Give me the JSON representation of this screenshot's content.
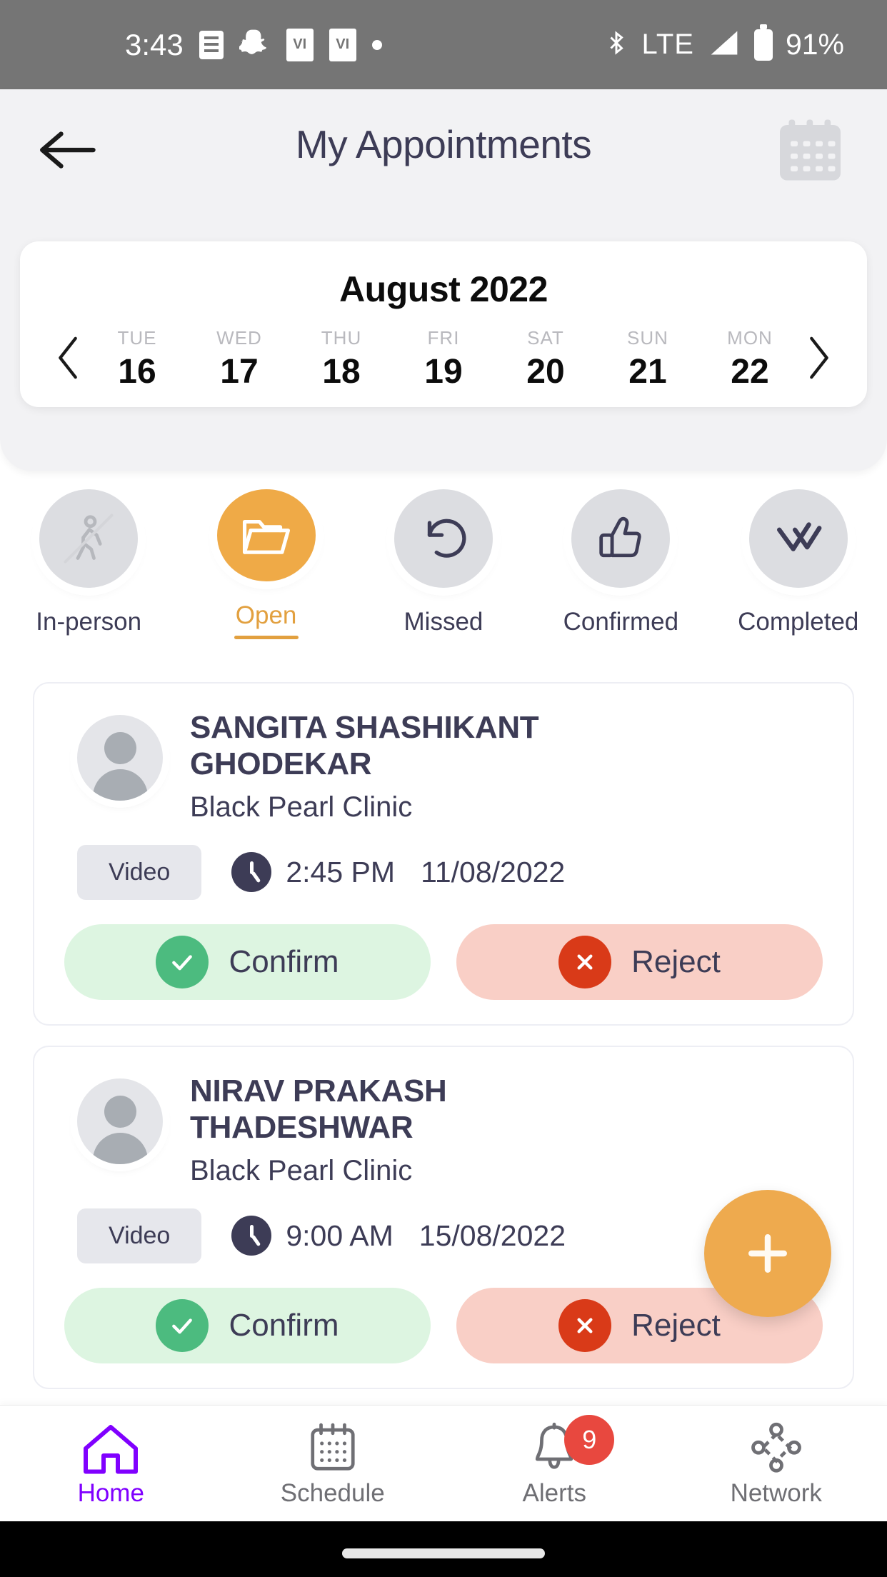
{
  "status_bar": {
    "time": "3:43",
    "network": "LTE",
    "battery": "91%",
    "icons": [
      "message-icon",
      "snapchat-icon",
      "vi-app-icon",
      "vi-app-icon",
      "dot-icon",
      "bluetooth-icon",
      "signal-icon",
      "battery-icon"
    ]
  },
  "header": {
    "title": "My Appointments",
    "back_icon": "back-arrow-icon",
    "calendar_icon": "calendar-icon"
  },
  "calendar": {
    "month": "August 2022",
    "prev_icon": "chevron-left-icon",
    "next_icon": "chevron-right-icon",
    "days": [
      {
        "dow": "TUE",
        "num": "16"
      },
      {
        "dow": "WED",
        "num": "17"
      },
      {
        "dow": "THU",
        "num": "18"
      },
      {
        "dow": "FRI",
        "num": "19"
      },
      {
        "dow": "SAT",
        "num": "20"
      },
      {
        "dow": "SUN",
        "num": "21"
      },
      {
        "dow": "MON",
        "num": "22"
      }
    ]
  },
  "filters": {
    "active": "Open",
    "items": [
      {
        "label": "In-person",
        "icon": "walking-person-icon",
        "active": false
      },
      {
        "label": "Open",
        "icon": "folder-icon",
        "active": true
      },
      {
        "label": "Missed",
        "icon": "undo-arrow-icon",
        "active": false
      },
      {
        "label": "Confirmed",
        "icon": "thumbs-up-icon",
        "active": false
      },
      {
        "label": "Completed",
        "icon": "double-check-icon",
        "active": false
      }
    ]
  },
  "appointments": [
    {
      "patient_name": "SANGITA SHASHIKANT GHODEKAR",
      "clinic": "Black Pearl Clinic",
      "mode": "Video",
      "time": "2:45 PM",
      "date": "11/08/2022",
      "confirm_label": "Confirm",
      "reject_label": "Reject"
    },
    {
      "patient_name": "NIRAV PRAKASH THADESHWAR",
      "clinic": "Black Pearl Clinic",
      "mode": "Video",
      "time": "9:00 AM",
      "date": "15/08/2022",
      "confirm_label": "Confirm",
      "reject_label": "Reject"
    }
  ],
  "fab": {
    "icon": "plus-icon"
  },
  "bottom_nav": {
    "items": [
      {
        "label": "Home",
        "icon": "home-icon",
        "active": true,
        "badge": ""
      },
      {
        "label": "Schedule",
        "icon": "calendar-icon",
        "active": false,
        "badge": ""
      },
      {
        "label": "Alerts",
        "icon": "bell-icon",
        "active": false,
        "badge": "9"
      },
      {
        "label": "Network",
        "icon": "network-icon",
        "active": false,
        "badge": ""
      }
    ]
  },
  "colors": {
    "accent_orange": "#eeaa4e",
    "active_purple": "#8000ff",
    "text_dark": "#3d3c56",
    "confirm_green": "#4cbb7f",
    "reject_red": "#d93a18",
    "badge_red": "#e8483f"
  }
}
